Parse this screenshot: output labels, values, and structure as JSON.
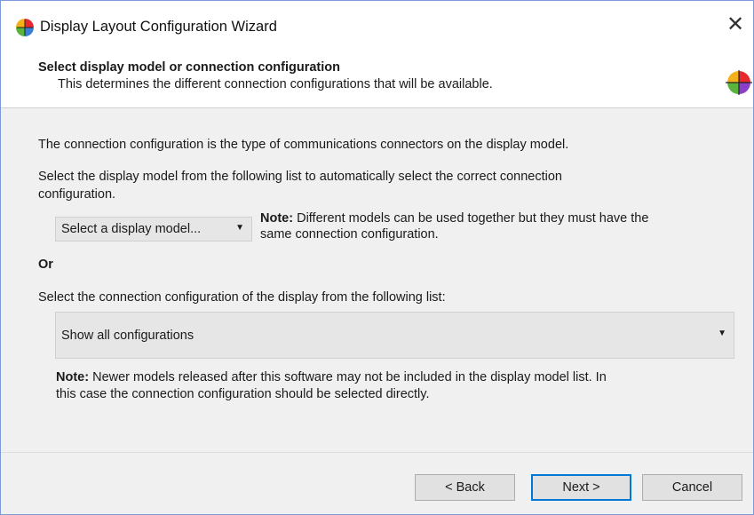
{
  "window": {
    "title": "Display Layout Configuration Wizard",
    "close_glyph": "✕"
  },
  "header": {
    "title": "Select display model or connection configuration",
    "subtitle": "This determines the different connection configurations that will be available.",
    "icon": "color-wheel-icon"
  },
  "content": {
    "intro": "The connection configuration is the type of communications connectors on the display model.",
    "instruction_line1": "Select the display model from the following list to automatically select the correct connection",
    "instruction_line2": "configuration.",
    "model_select": {
      "value": "Select a display model...",
      "arrow": "▼"
    },
    "model_note": {
      "label": "Note:",
      "line1": " Different models can be used together but they must have the",
      "line2": "same connection configuration."
    },
    "or_label": "Or",
    "config_instruction": "Select the connection configuration of the display from the following list:",
    "config_select": {
      "value": "Show all configurations",
      "arrow": "▼"
    },
    "bottom_note": {
      "label": "Note:",
      "line1": " Newer models released after this software may not be included in the display model list. In",
      "line2": "this case the connection configuration should be selected directly."
    }
  },
  "footer": {
    "back_label": "< Back",
    "next_label": "Next >",
    "cancel_label": "Cancel"
  },
  "colors": {
    "accent": "#0078d7",
    "background": "#f0f0f0",
    "header_bg": "#ffffff"
  }
}
